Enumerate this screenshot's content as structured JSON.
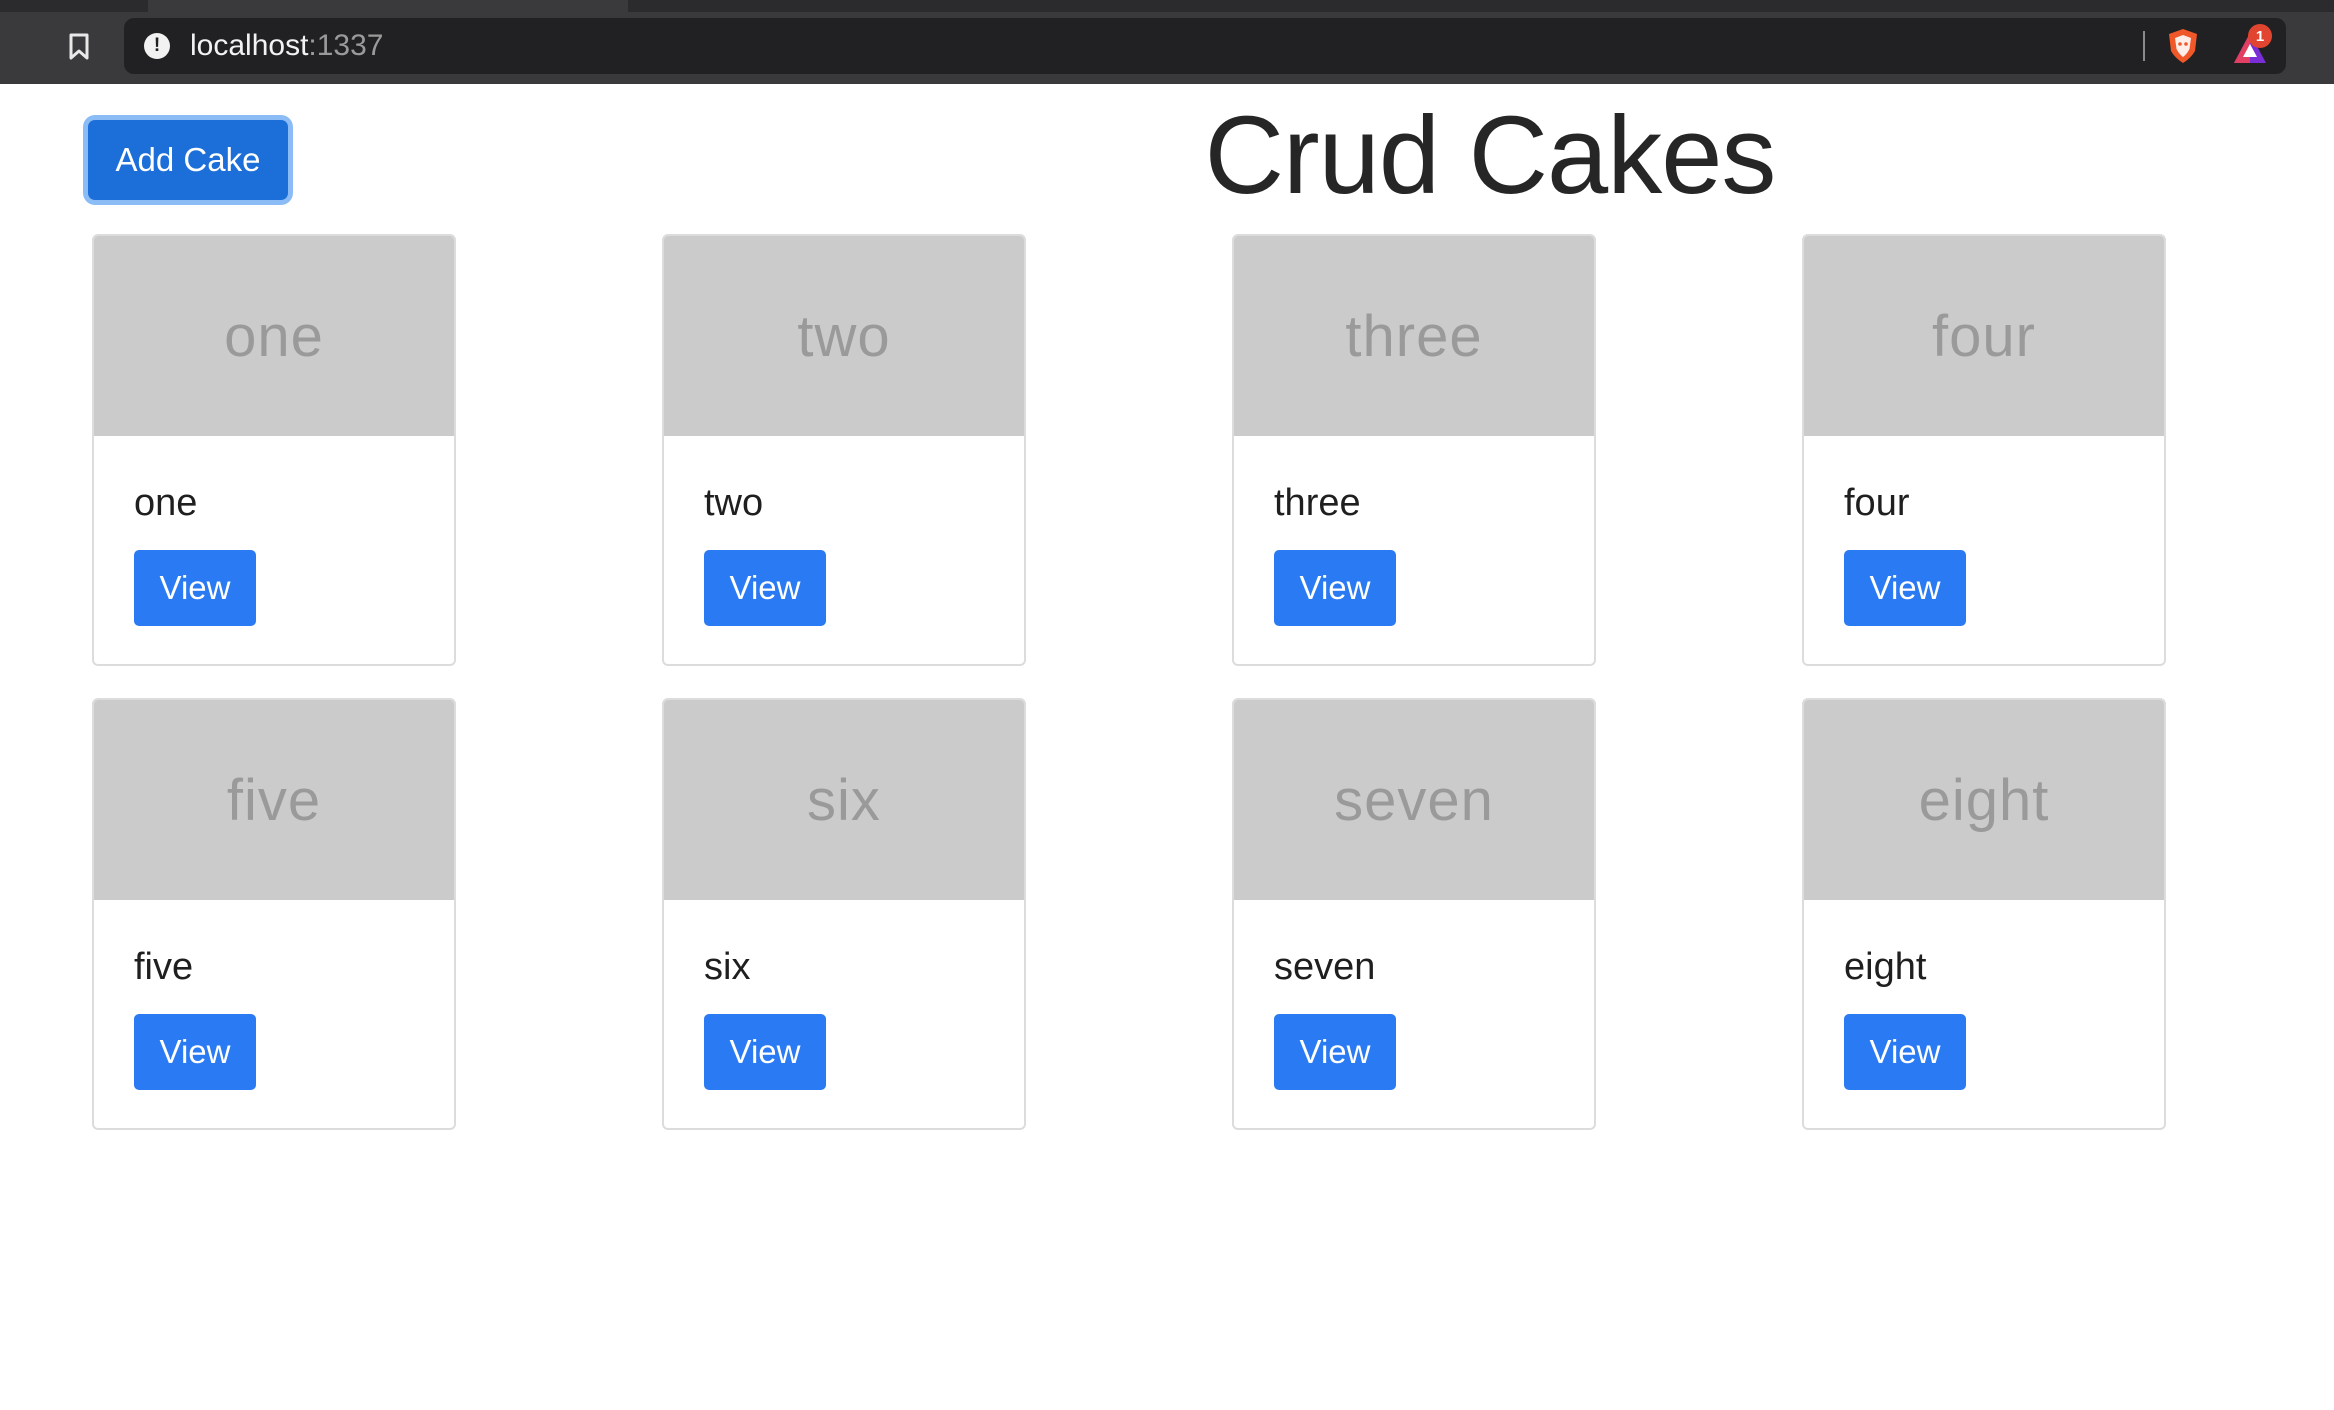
{
  "browser": {
    "url_host": "localhost",
    "url_port": ":1337",
    "notification_count": "1",
    "icons": [
      "bookmark-icon",
      "info-icon",
      "brave-shield-icon",
      "brave-rewards-icon"
    ]
  },
  "header": {
    "add_button_label": "Add Cake",
    "title": "Crud Cakes"
  },
  "cakes": [
    {
      "image_label": "one",
      "title": "one",
      "button": "View"
    },
    {
      "image_label": "two",
      "title": "two",
      "button": "View"
    },
    {
      "image_label": "three",
      "title": "three",
      "button": "View"
    },
    {
      "image_label": "four",
      "title": "four",
      "button": "View"
    },
    {
      "image_label": "five",
      "title": "five",
      "button": "View"
    },
    {
      "image_label": "six",
      "title": "six",
      "button": "View"
    },
    {
      "image_label": "seven",
      "title": "seven",
      "button": "View"
    },
    {
      "image_label": "eight",
      "title": "eight",
      "button": "View"
    }
  ],
  "colors": {
    "primary": "#2a7af3",
    "primary_active": "#1c6fd9",
    "placeholder_bg": "#cbcbcb",
    "placeholder_text": "#9a9a9a"
  }
}
